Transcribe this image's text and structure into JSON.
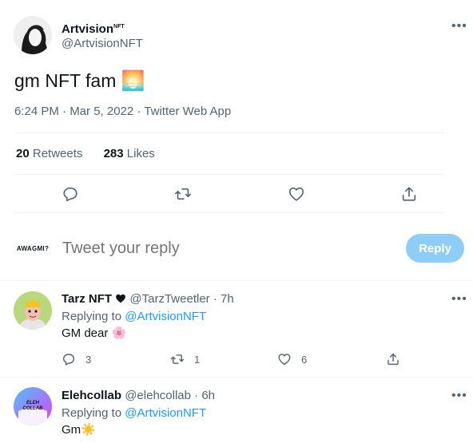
{
  "main_tweet": {
    "author_name": "Artvision",
    "author_name_suffix": "NFT",
    "author_handle": "@ArtvisionNFT",
    "text": "gm NFT fam",
    "emoji": "🌅",
    "meta": "6:24 PM · Mar 5, 2022 · Twitter Web App",
    "retweets_count": "20",
    "retweets_label": "Retweets",
    "likes_count": "283",
    "likes_label": "Likes"
  },
  "reply_box": {
    "avatar_text": "AWAGMI?",
    "placeholder": "Tweet your reply",
    "button_label": "Reply"
  },
  "replies": [
    {
      "author_name": "Tarz NFT",
      "author_handle": "@TarzTweetler",
      "time": "7h",
      "replying_prefix": "Replying to",
      "replying_to": "@ArtvisionNFT",
      "text": "GM dear 🌸",
      "reply_count": "3",
      "retweet_count": "1",
      "like_count": "6"
    },
    {
      "author_name": "Elehcollab",
      "author_handle": "@elehcollab",
      "time": "6h",
      "replying_prefix": "Replying to",
      "replying_to": "@ArtvisionNFT",
      "text": "Gm☀️",
      "avatar_text": "ELEH COLLAB"
    }
  ],
  "colors": {
    "accent": "#1d9bf0",
    "reply_button_disabled": "#8ecdf8",
    "muted_text": "#536471",
    "divider": "#eff3f4"
  }
}
